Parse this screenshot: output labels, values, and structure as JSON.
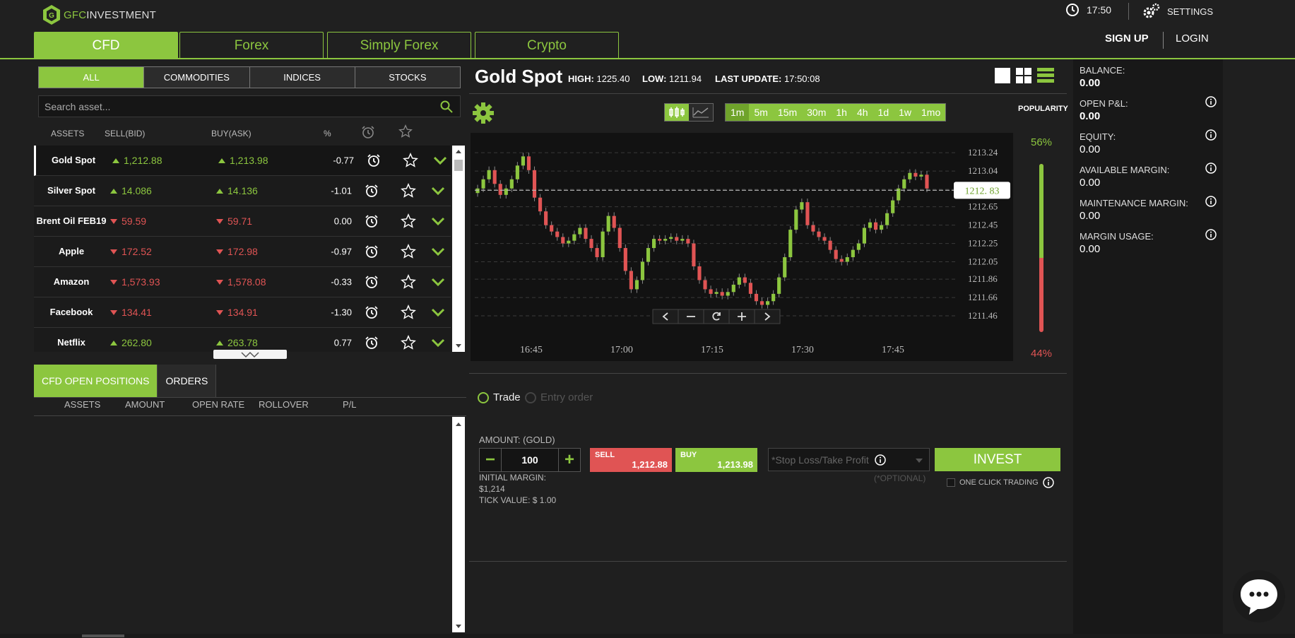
{
  "brand": {
    "logo_prefix": "GFC",
    "logo_suffix": "INVESTMENT"
  },
  "header": {
    "time": "17:50",
    "settings_label": "SETTINGS",
    "tabs": [
      {
        "label": "CFD",
        "active": true
      },
      {
        "label": "Forex",
        "active": false
      },
      {
        "label": "Simply Forex",
        "active": false
      },
      {
        "label": "Crypto",
        "active": false
      }
    ],
    "sign_up": "SIGN UP",
    "login": "LOGIN"
  },
  "filters": [
    "ALL",
    "COMMODITIES",
    "INDICES",
    "STOCKS"
  ],
  "search": {
    "placeholder": "Search asset..."
  },
  "asset_columns": [
    "ASSETS",
    "SELL(BID)",
    "BUY(ASK)",
    "%"
  ],
  "assets": [
    {
      "name": "Gold Spot",
      "sell": "1,212.88",
      "buy": "1,213.98",
      "pct": "-0.77",
      "dir": "up"
    },
    {
      "name": "Silver Spot",
      "sell": "14.086",
      "buy": "14.136",
      "pct": "-1.01",
      "dir": "up"
    },
    {
      "name": "Brent Oil FEB19",
      "sell": "59.59",
      "buy": "59.71",
      "pct": "0.00",
      "dir": "down"
    },
    {
      "name": "Apple",
      "sell": "172.52",
      "buy": "172.98",
      "pct": "-0.97",
      "dir": "down"
    },
    {
      "name": "Amazon",
      "sell": "1,573.93",
      "buy": "1,578.08",
      "pct": "-0.33",
      "dir": "down"
    },
    {
      "name": "Facebook",
      "sell": "134.41",
      "buy": "134.91",
      "pct": "-1.30",
      "dir": "down"
    },
    {
      "name": "Netflix",
      "sell": "262.80",
      "buy": "263.78",
      "pct": "0.77",
      "dir": "up"
    }
  ],
  "positions": {
    "tabs": [
      {
        "label": "CFD OPEN POSITIONS",
        "active": true
      },
      {
        "label": "ORDERS",
        "active": false
      }
    ],
    "columns": [
      "ASSETS",
      "AMOUNT",
      "OPEN RATE",
      "ROLLOVER",
      "P/L"
    ]
  },
  "instrument": {
    "name": "Gold Spot",
    "high_label": "HIGH:",
    "high": "1225.40",
    "low_label": "LOW:",
    "low": "1211.94",
    "update_label": "LAST UPDATE:",
    "update": "17:50:08"
  },
  "timeframes": [
    {
      "label": "1m",
      "active": true
    },
    {
      "label": "5m"
    },
    {
      "label": "15m"
    },
    {
      "label": "30m"
    },
    {
      "label": "1h"
    },
    {
      "label": "4h"
    },
    {
      "label": "1d"
    },
    {
      "label": "1w"
    },
    {
      "label": "1mo"
    }
  ],
  "popularity": {
    "label": "POPULARITY",
    "buy_pct": "56%",
    "sell_pct": "44%",
    "buy_fraction": 0.56
  },
  "chart_data": {
    "type": "candlestick",
    "x_ticks": [
      "16:45",
      "17:00",
      "17:15",
      "17:30",
      "17:45"
    ],
    "y_ticks": [
      "1213.24",
      "1213.04",
      "1212.65",
      "1212.45",
      "1212.25",
      "1212.05",
      "1211.86",
      "1211.66",
      "1211.46"
    ],
    "y_tick_values": [
      1213.24,
      1213.04,
      1212.84,
      1212.65,
      1212.45,
      1212.25,
      1212.05,
      1211.86,
      1211.66,
      1211.46
    ],
    "ylim": [
      1211.36,
      1213.38
    ],
    "current_price": "1212. 83",
    "current_value": 1212.83,
    "grid": true,
    "closes": [
      1212.85,
      1212.95,
      1213.05,
      1212.9,
      1212.78,
      1212.85,
      1212.95,
      1213.1,
      1213.2,
      1213.05,
      1212.75,
      1212.6,
      1212.45,
      1212.38,
      1212.32,
      1212.25,
      1212.28,
      1212.35,
      1212.42,
      1212.3,
      1212.2,
      1212.1,
      1212.38,
      1212.55,
      1212.42,
      1212.2,
      1211.95,
      1211.75,
      1211.85,
      1212.05,
      1212.2,
      1212.3,
      1212.28,
      1212.3,
      1212.32,
      1212.28,
      1212.3,
      1212.25,
      1212.0,
      1211.85,
      1211.75,
      1211.7,
      1211.72,
      1211.68,
      1211.72,
      1211.8,
      1211.88,
      1211.82,
      1211.7,
      1211.62,
      1211.58,
      1211.62,
      1211.7,
      1211.88,
      1212.1,
      1212.4,
      1212.62,
      1212.7,
      1212.45,
      1212.38,
      1212.32,
      1212.28,
      1212.18,
      1212.08,
      1212.05,
      1212.1,
      1212.18,
      1212.25,
      1212.42,
      1212.48,
      1212.4,
      1212.45,
      1212.58,
      1212.72,
      1212.85,
      1212.95,
      1213.02,
      1212.98,
      1213.0,
      1212.85
    ]
  },
  "trade": {
    "mode_trade": "Trade",
    "mode_entry": "Entry order",
    "amount_label": "AMOUNT: (GOLD)",
    "amount": "100",
    "minus": "−",
    "plus": "+",
    "margin_label": "INITIAL MARGIN:",
    "margin_value": "$1,214",
    "tick_value": "TICK VALUE: $ 1.00",
    "sell_label": "SELL",
    "sell_price": "1,212.88",
    "buy_label": "BUY",
    "buy_price": "1,213.98",
    "sltp_placeholder": "*Stop Loss/Take Profit",
    "optional": "(*OPTIONAL)",
    "invest": "INVEST",
    "one_click": "ONE CLICK TRADING"
  },
  "account": [
    {
      "label": "BALANCE:",
      "value": "0.00",
      "bold": true
    },
    {
      "label": "OPEN P&L:",
      "value": "0.00",
      "bold": true
    },
    {
      "label": "EQUITY:",
      "value": "0.00"
    },
    {
      "label": "AVAILABLE MARGIN:",
      "value": "0.00"
    },
    {
      "label": "MAINTENANCE MARGIN:",
      "value": "0.00"
    },
    {
      "label": "MARGIN USAGE:",
      "value": "0.00"
    }
  ],
  "colors": {
    "accent": "#8cc63f",
    "down": "#e05454",
    "background": "#1f1f1f"
  }
}
